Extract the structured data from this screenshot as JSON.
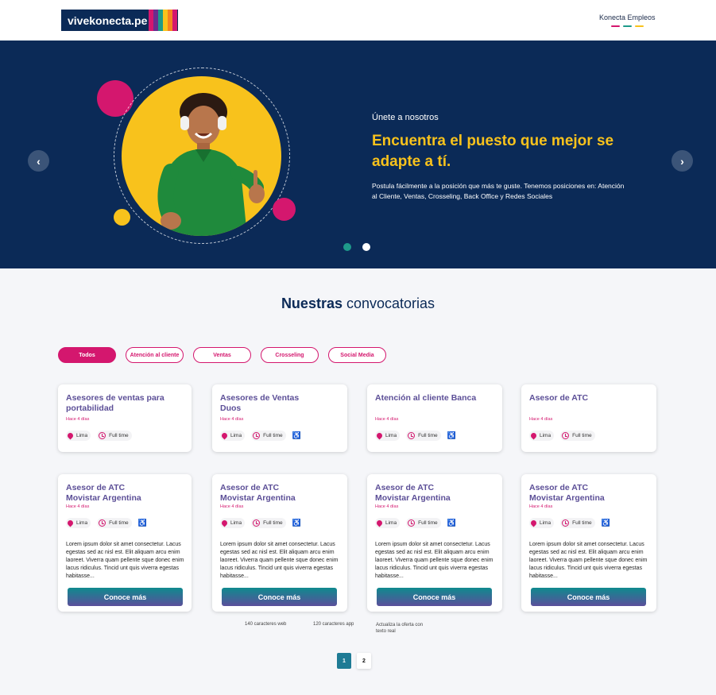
{
  "header": {
    "logo_text": "vivekonecta.pe",
    "logo_stripes": [
      "#d4176e",
      "#6a2d8e",
      "#1e9a8a",
      "#f8c21c",
      "#f58220",
      "#d4176e"
    ],
    "nav_link": "Konecta Empleos",
    "nav_dash_colors": [
      "#d4176e",
      "#1e9a8a",
      "#f8c21c"
    ]
  },
  "hero": {
    "eyebrow": "Únete a nosotros",
    "title": "Encuentra el puesto que mejor se adapte a tí.",
    "description": "Postula fácilmente a la posición que más te guste. Tenemos posiciones en: Atención al Cliente, Ventas, Crosseling, Back Office y Redes Sociales",
    "prev_icon": "‹",
    "next_icon": "›",
    "active_slide": 1,
    "slide_count": 2
  },
  "section": {
    "title_bold": "Nuestras",
    "title_rest": " convocatorias"
  },
  "filters": [
    {
      "label": "Todos",
      "active": true
    },
    {
      "label": "Atención al cliente",
      "active": false
    },
    {
      "label": "Ventas",
      "active": false
    },
    {
      "label": "Crosseling",
      "active": false
    },
    {
      "label": "Social Media",
      "active": false
    }
  ],
  "jobs_row1": [
    {
      "title": "Asesores de ventas para portabilidad",
      "time": "Hace 4 días",
      "location": "Lima",
      "schedule": "Full time",
      "accessible": false
    },
    {
      "title": "Asesores de Ventas Duos",
      "time": "Hace 4 días",
      "location": "Lima",
      "schedule": "Full time",
      "accessible": true
    },
    {
      "title": "Atención al cliente Banca",
      "time": "Hace 4 días",
      "location": "Lima",
      "schedule": "Full time",
      "accessible": true
    },
    {
      "title": "Asesor de ATC",
      "time": "Hace 4 días",
      "location": "Lima",
      "schedule": "Full time",
      "accessible": false
    }
  ],
  "jobs_row2": [
    {
      "title": "Asesor de ATC Movistar Argentina",
      "time": "Hace 4 días",
      "location": "Lima",
      "schedule": "Full time",
      "accessible": true,
      "description": "Lorem ipsum dolor sit amet consectetur. Lacus egestas sed ac nisl est. Elit aliquam arcu enim laoreet. Viverra quam pellente sque donec enim lacus ridiculus. Tincid unt quis viverra egestas habitasse...",
      "button": "Conoce más"
    },
    {
      "title": "Asesor de ATC Movistar Argentina",
      "time": "Hace 4 días",
      "location": "Lima",
      "schedule": "Full time",
      "accessible": true,
      "description": "Lorem ipsum dolor sit amet consectetur. Lacus egestas sed ac nisl est. Elit aliquam arcu enim laoreet. Viverra quam pellente sque donec enim lacus ridiculus. Tincid unt quis viverra egestas habitasse...",
      "button": "Conoce más"
    },
    {
      "title": "Asesor de ATC Movistar Argentina",
      "time": "Hace 4 días",
      "location": "Lima",
      "schedule": "Full time",
      "accessible": true,
      "description": "Lorem ipsum dolor sit amet consectetur. Lacus egestas sed ac nisl est. Elit aliquam arcu enim laoreet. Viverra quam pellente sque donec enim lacus ridiculus. Tincid unt quis viverra egestas habitasse...",
      "button": "Conoce más"
    },
    {
      "title": "Asesor de ATC Movistar Argentina",
      "time": "Hace 4 días",
      "location": "Lima",
      "schedule": "Full time",
      "accessible": true,
      "description": "Lorem ipsum dolor sit amet consectetur. Lacus egestas sed ac nisl est. Elit aliquam arcu enim laoreet. Viverra quam pellente sque donec enim lacus ridiculus. Tincid unt quis viverra egestas habitasse...",
      "button": "Conoce más"
    }
  ],
  "notes": {
    "web": "140 caracteres web",
    "app": "120 caracteres app",
    "update": "Actualiza la oferta con texto real"
  },
  "pagination": {
    "pages": [
      "1",
      "2"
    ],
    "current": "1"
  },
  "colors": {
    "navy": "#0b2a57",
    "magenta": "#d4176e",
    "yellow": "#f8c21c",
    "teal": "#1e9a8a",
    "purple_title": "#5c4f97"
  },
  "icons": {
    "location": "location-pin-icon",
    "schedule": "clock-icon",
    "accessibility": "wheelchair-icon",
    "accessibility_glyph": "♿"
  }
}
